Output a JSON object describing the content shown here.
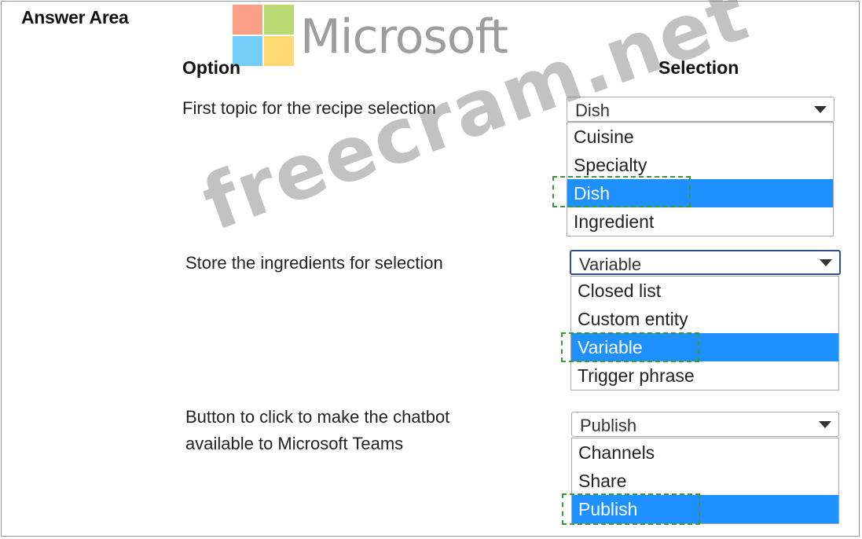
{
  "header": {
    "answer_area": "Answer Area",
    "logo_text": "Microsoft",
    "option_heading": "Option",
    "selection_heading": "Selection"
  },
  "rows": [
    {
      "option": "First topic for the recipe selection",
      "selected": "Dish",
      "options": [
        "Cuisine",
        "Specialty",
        "Dish",
        "Ingredient"
      ]
    },
    {
      "option": "Store the ingredients for selection",
      "selected": "Variable",
      "options": [
        "Closed list",
        "Custom entity",
        "Variable",
        "Trigger phrase"
      ]
    },
    {
      "option_line1": "Button to click to make the chatbot",
      "option_line2": "available to Microsoft Teams",
      "selected": "Publish",
      "options": [
        "Channels",
        "Share",
        "Publish"
      ]
    }
  ],
  "watermark": "freecram.net",
  "colors": {
    "highlight": "#1e90ff",
    "dashed_marker": "#3a9a3a",
    "active_border": "#2f4f8f"
  }
}
